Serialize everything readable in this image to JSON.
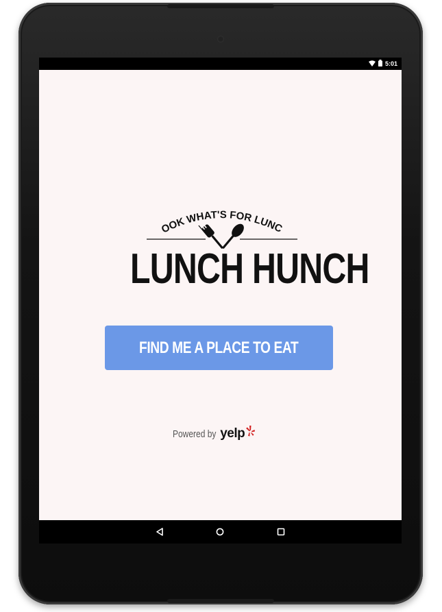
{
  "status_bar": {
    "time": "5:01",
    "icons": [
      "wifi-icon",
      "battery-icon"
    ]
  },
  "logo": {
    "tagline": "LOOK WHAT'S FOR LUNCH",
    "title": "LUNCH HUNCH",
    "emblem_icons": [
      "fork-icon",
      "spoon-icon"
    ]
  },
  "main": {
    "cta_label": "FIND ME A PLACE TO EAT",
    "cta_color": "#6b98e7",
    "background_color": "#fcf5f5"
  },
  "footer": {
    "powered_label": "Powered by",
    "brand": "yelp",
    "brand_accent_color": "#d32323"
  },
  "nav": {
    "buttons": [
      "back-icon",
      "home-icon",
      "recents-icon"
    ]
  }
}
